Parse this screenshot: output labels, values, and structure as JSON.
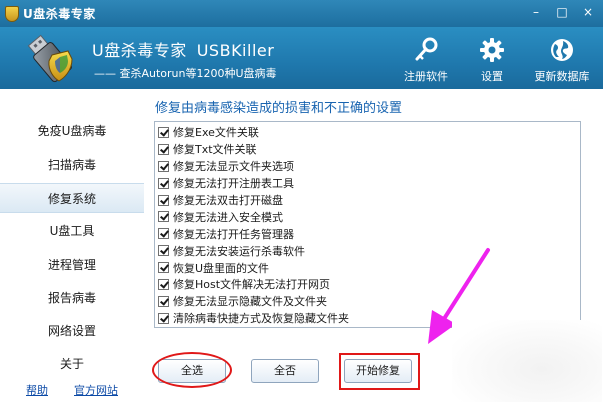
{
  "window": {
    "title": "U盘杀毒专家"
  },
  "controls": {
    "minimize": "–",
    "restore": "□",
    "close": "×"
  },
  "header": {
    "app_name_cn": "U盘杀毒专家",
    "app_name_en": "USBKiller",
    "slogan": "—— 查杀Autorun等1200种U盘病毒",
    "tools": [
      {
        "label": "注册软件",
        "icon": "key-icon"
      },
      {
        "label": "设置",
        "icon": "gear-icon"
      },
      {
        "label": "更新数据库",
        "icon": "globe-icon"
      }
    ]
  },
  "sidebar": {
    "items": [
      {
        "label": "免疫U盘病毒"
      },
      {
        "label": "扫描病毒"
      },
      {
        "label": "修复系统",
        "active": true
      },
      {
        "label": "U盘工具"
      },
      {
        "label": "进程管理"
      },
      {
        "label": "报告病毒"
      },
      {
        "label": "网络设置"
      },
      {
        "label": "关于"
      }
    ],
    "links": {
      "help": "帮助",
      "site": "官方网站"
    }
  },
  "main": {
    "title": "修复由病毒感染造成的损害和不正确的设置",
    "options": [
      {
        "label": "修复Exe文件关联",
        "checked": true
      },
      {
        "label": "修复Txt文件关联",
        "checked": true
      },
      {
        "label": "修复无法显示文件夹选项",
        "checked": true
      },
      {
        "label": "修复无法打开注册表工具",
        "checked": true
      },
      {
        "label": "修复无法双击打开磁盘",
        "checked": true
      },
      {
        "label": "修复无法进入安全模式",
        "checked": true
      },
      {
        "label": "修复无法打开任务管理器",
        "checked": true
      },
      {
        "label": "修复无法安装运行杀毒软件",
        "checked": true
      },
      {
        "label": "恢复U盘里面的文件",
        "checked": true
      },
      {
        "label": "修复Host文件解决无法打开网页",
        "checked": true
      },
      {
        "label": "修复无法显示隐藏文件及文件夹",
        "checked": true
      },
      {
        "label": "清除病毒快捷方式及恢复隐藏文件夹",
        "checked": true
      }
    ],
    "buttons": {
      "select_all": "全选",
      "select_none": "全否",
      "start_repair": "开始修复"
    }
  },
  "colors": {
    "titlebar": "#2f87b8",
    "header": "#1f78ad",
    "section_title": "#1864b0",
    "annotation_red": "#e01818",
    "annotation_arrow": "#ee22ee"
  }
}
